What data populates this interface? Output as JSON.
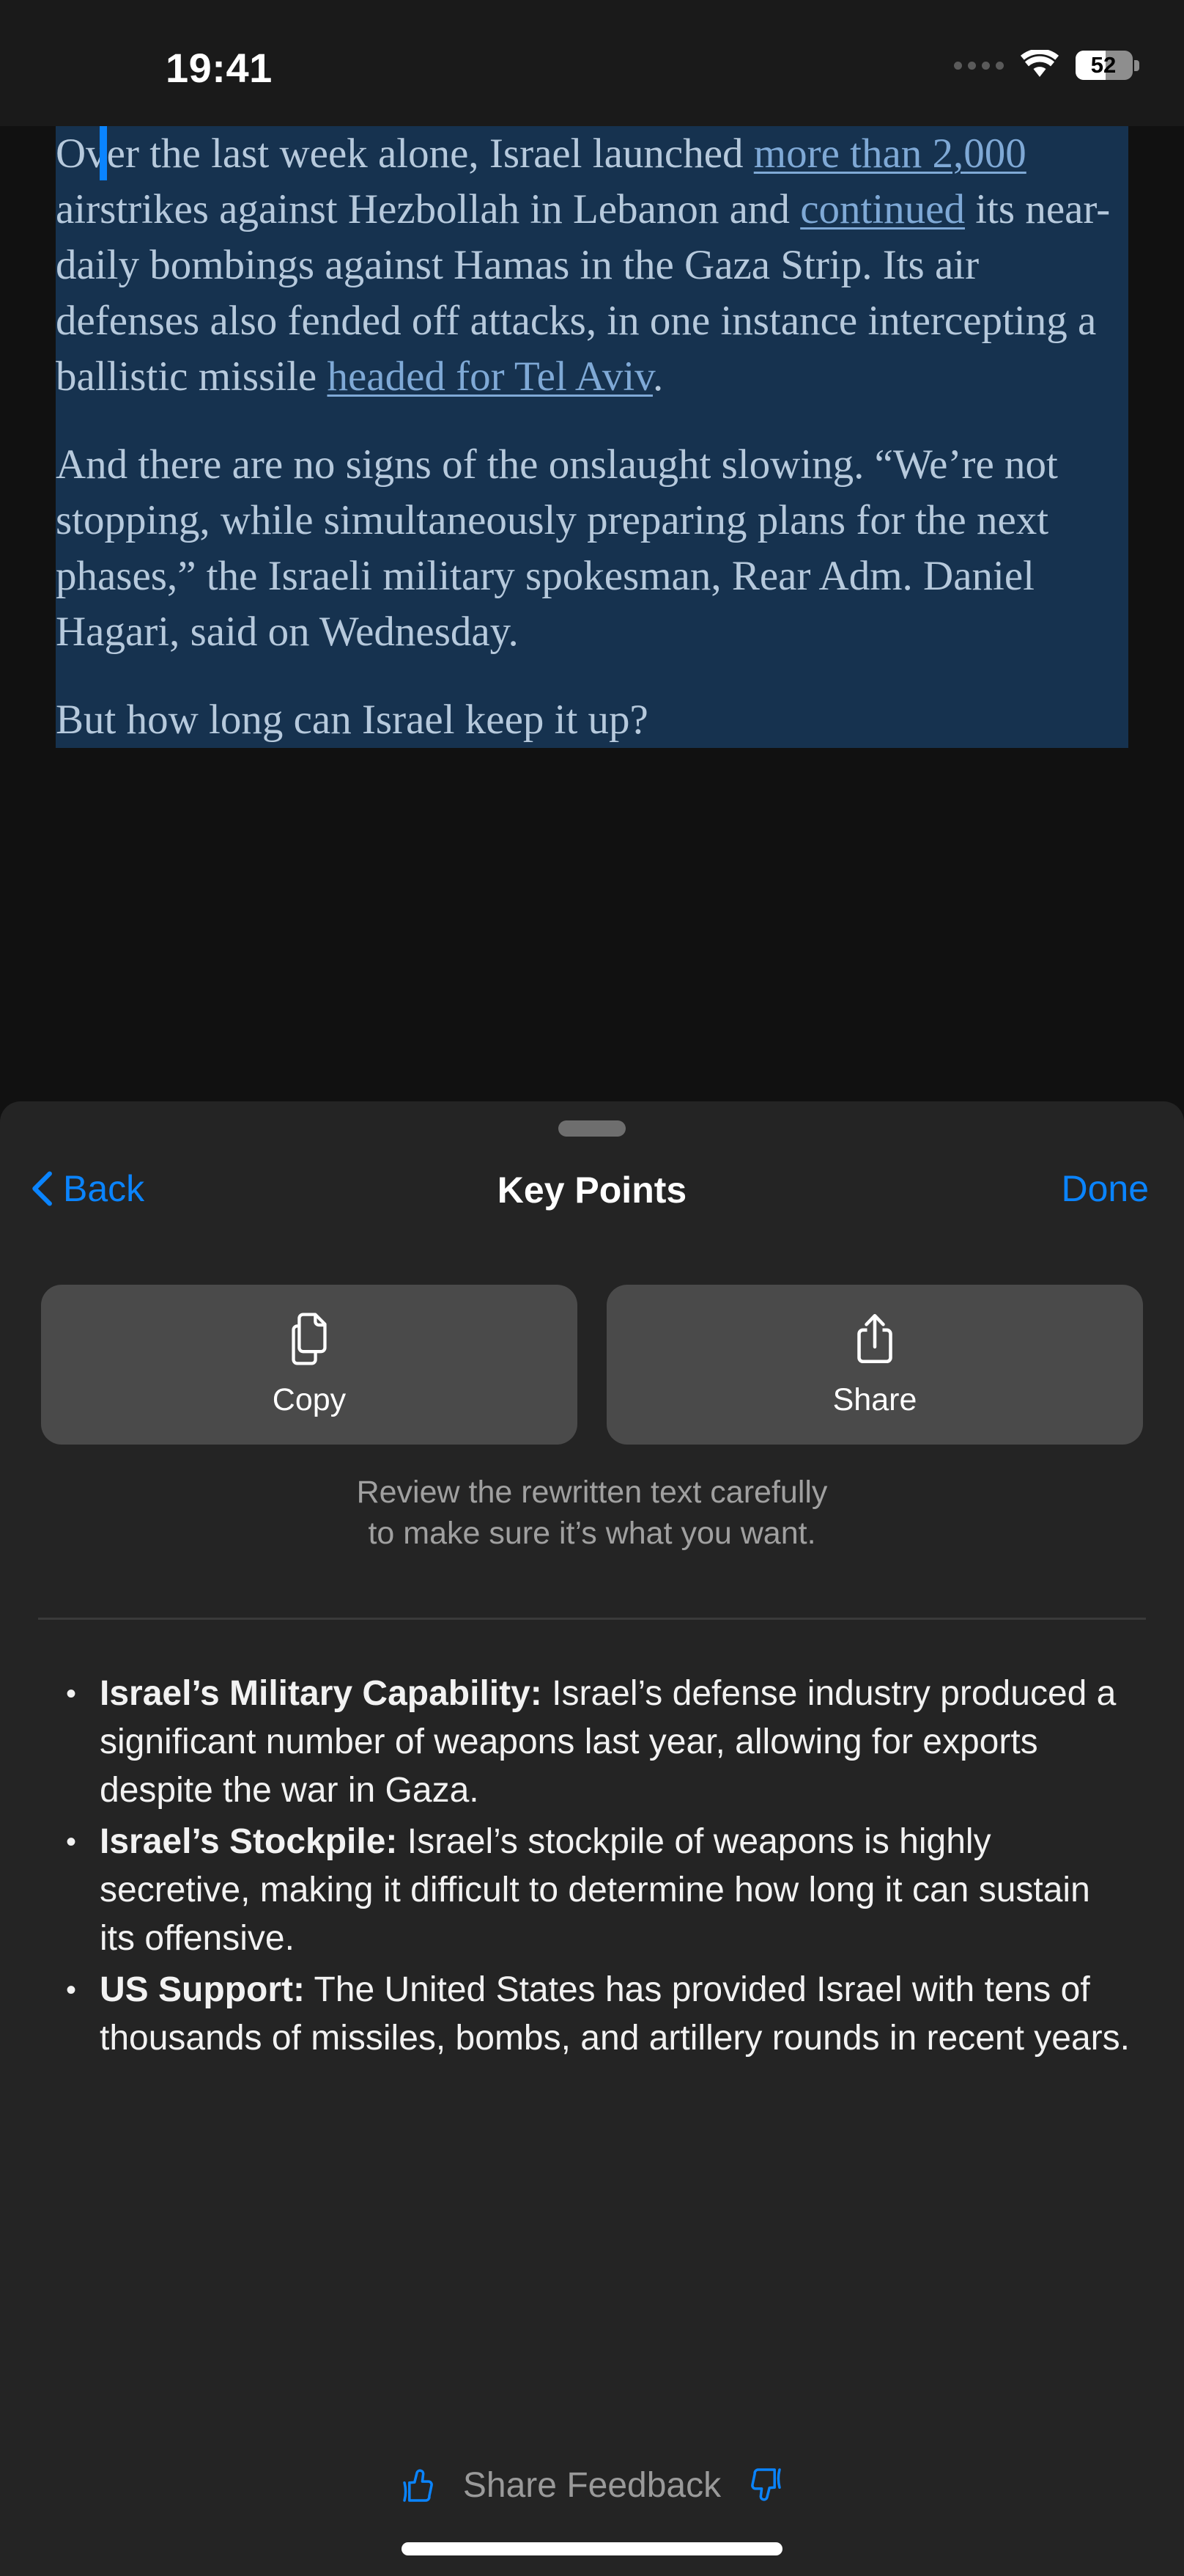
{
  "status_bar": {
    "time": "19:41",
    "battery_level": "52",
    "battery_percent": 52,
    "icons": [
      "signal-dots-icon",
      "wifi-icon",
      "battery-icon"
    ]
  },
  "article": {
    "selection_active": true,
    "selection_color": "#16324f",
    "text_color": "#b6c9dc",
    "link_color": "#7fa9d6",
    "paragraphs": [
      {
        "runs": [
          {
            "text": "Over the last week alone, Israel launched ",
            "link": false
          },
          {
            "text": "more than 2,000",
            "link": true
          },
          {
            "text": " airstrikes against Hezbollah in Lebanon and ",
            "link": false
          },
          {
            "text": "continued",
            "link": true
          },
          {
            "text": " its near-daily bombings against Hamas in the Gaza Strip. Its air defenses also fended off attacks, in one instance intercepting a ballistic missile ",
            "link": false
          },
          {
            "text": "headed for Tel Aviv",
            "link": true
          },
          {
            "text": ".",
            "link": false
          }
        ]
      },
      {
        "runs": [
          {
            "text": "And there are no signs of the onslaught slowing. “We’re not stopping, while simultaneously preparing plans for the next phases,” the Israeli military spokesman, Rear Adm. Daniel Hagari, said on Wednesday.",
            "link": false
          }
        ]
      },
      {
        "runs": [
          {
            "text": "But how long can Israel keep it up?",
            "link": false
          }
        ]
      }
    ]
  },
  "sheet": {
    "title": "Key Points",
    "back_label": "Back",
    "done_label": "Done",
    "grabber": "sheet-grabber",
    "actions": [
      {
        "label": "Copy",
        "icon": "copy-icon"
      },
      {
        "label": "Share",
        "icon": "share-icon"
      }
    ],
    "disclaimer_line1": "Review the rewritten text carefully",
    "disclaimer_line2": "to make sure it’s what you want.",
    "key_points": [
      {
        "heading": "Israel’s Military Capability:",
        "body": " Israel’s defense industry produced a significant number of weapons last year, allowing for exports despite the war in Gaza."
      },
      {
        "heading": "Israel’s Stockpile:",
        "body": " Israel’s stockpile of weapons is highly secretive, making it difficult to determine how long it can sustain its offensive."
      },
      {
        "heading": "US Support:",
        "body": " The United States has provided Israel with tens of thousands of missiles, bombs, and artillery rounds in recent years."
      }
    ],
    "feedback": {
      "label": "Share Feedback",
      "thumbs_up_icon": "thumbs-up-icon",
      "thumbs_down_icon": "thumbs-down-icon"
    }
  },
  "colors": {
    "accent": "#0a84ff",
    "sheet_background": "#242424",
    "action_button_background": "#4a4a4a",
    "page_background": "#111111",
    "status_bar_background": "#1a1a1a",
    "selection_highlight": "#16324f",
    "divider": "#3a3a3a"
  }
}
